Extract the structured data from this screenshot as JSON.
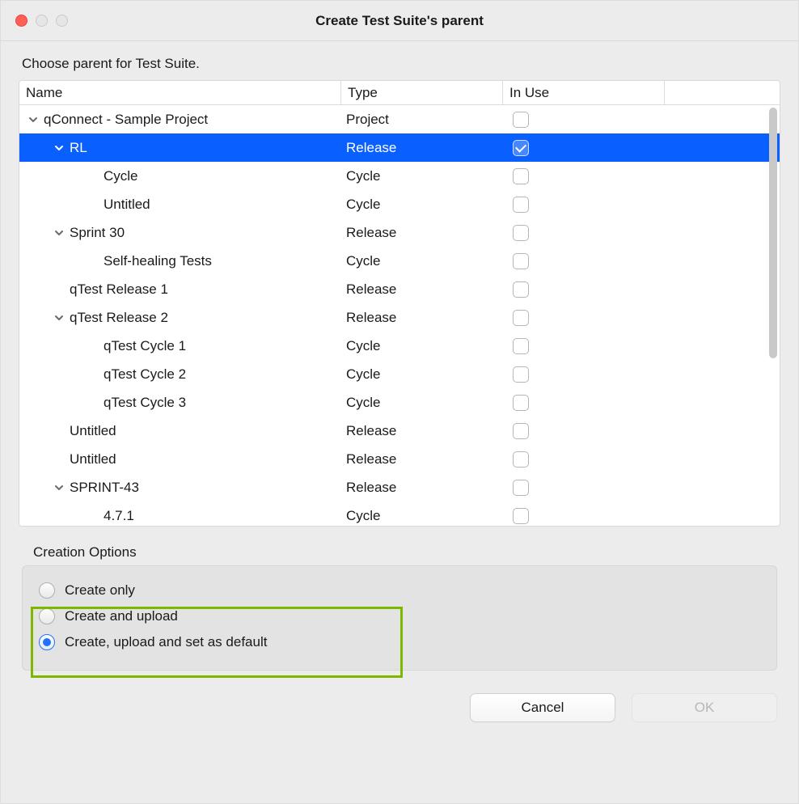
{
  "window": {
    "title": "Create Test Suite's parent"
  },
  "instruction": "Choose parent for Test Suite.",
  "columns": {
    "name": "Name",
    "type": "Type",
    "inuse": "In Use"
  },
  "rows": [
    {
      "indent": 0,
      "expand": true,
      "label": "qConnect - Sample Project",
      "type": "Project",
      "checked": false,
      "selected": false
    },
    {
      "indent": 1,
      "expand": true,
      "label": "RL",
      "type": "Release",
      "checked": true,
      "selected": true
    },
    {
      "indent": 2,
      "expand": false,
      "label": "Cycle",
      "type": "Cycle",
      "checked": false,
      "selected": false
    },
    {
      "indent": 2,
      "expand": false,
      "label": "Untitled",
      "type": "Cycle",
      "checked": false,
      "selected": false
    },
    {
      "indent": 1,
      "expand": true,
      "label": "Sprint 30",
      "type": "Release",
      "checked": false,
      "selected": false
    },
    {
      "indent": 2,
      "expand": false,
      "label": "Self-healing Tests",
      "type": "Cycle",
      "checked": false,
      "selected": false
    },
    {
      "indent": 1,
      "expand": false,
      "label": "qTest Release 1",
      "type": "Release",
      "checked": false,
      "selected": false
    },
    {
      "indent": 1,
      "expand": true,
      "label": "qTest Release 2",
      "type": "Release",
      "checked": false,
      "selected": false
    },
    {
      "indent": 2,
      "expand": false,
      "label": "qTest Cycle 1",
      "type": "Cycle",
      "checked": false,
      "selected": false
    },
    {
      "indent": 2,
      "expand": false,
      "label": "qTest Cycle 2",
      "type": "Cycle",
      "checked": false,
      "selected": false
    },
    {
      "indent": 2,
      "expand": false,
      "label": "qTest Cycle 3",
      "type": "Cycle",
      "checked": false,
      "selected": false
    },
    {
      "indent": 1,
      "expand": false,
      "label": "Untitled",
      "type": "Release",
      "checked": false,
      "selected": false
    },
    {
      "indent": 1,
      "expand": false,
      "label": "Untitled",
      "type": "Release",
      "checked": false,
      "selected": false
    },
    {
      "indent": 1,
      "expand": true,
      "label": "SPRINT-43",
      "type": "Release",
      "checked": false,
      "selected": false
    },
    {
      "indent": 2,
      "expand": false,
      "label": "4.7.1",
      "type": "Cycle",
      "checked": false,
      "selected": false
    }
  ],
  "options": {
    "title": "Creation Options",
    "items": [
      {
        "label": "Create only",
        "checked": false
      },
      {
        "label": "Create and upload",
        "checked": false
      },
      {
        "label": "Create, upload and set as default",
        "checked": true
      }
    ]
  },
  "buttons": {
    "cancel": "Cancel",
    "ok": "OK"
  }
}
